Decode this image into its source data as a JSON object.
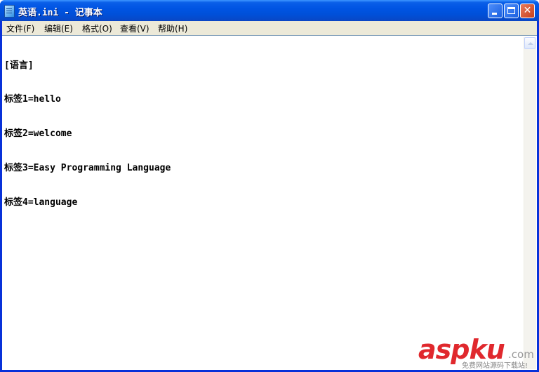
{
  "window": {
    "title": "英语.ini - 记事本"
  },
  "menu": [
    {
      "label": "文件(F)"
    },
    {
      "label": "编辑(E)"
    },
    {
      "label": "格式(O)"
    },
    {
      "label": "查看(V)"
    },
    {
      "label": "帮助(H)"
    }
  ],
  "editor": {
    "lines": [
      "[语言]",
      "标签1=hello",
      "标签2=welcome",
      "标签3=Easy Programming Language",
      "标签4=language"
    ]
  },
  "watermark": {
    "brand": "aspku",
    "domain": ".com",
    "tagline": "免费网站源码下载站!"
  },
  "colors": {
    "titlebar": "#0054e3",
    "menubar": "#ece9d8",
    "watermark": "#e0282d"
  }
}
